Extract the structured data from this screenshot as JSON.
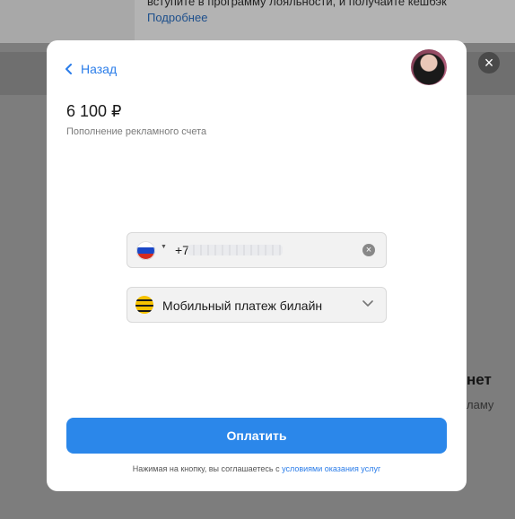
{
  "background": {
    "text_line1": "вступите в программу лояльности, и получайте кешбэк",
    "link": "Подробнее",
    "right_heading": "нет",
    "right_text": "ламу"
  },
  "modal": {
    "back_label": "Назад",
    "amount": "6 100 ₽",
    "subtitle": "Пополнение рекламного счета",
    "phone": {
      "country_icon": "russia-flag",
      "prefix": "+7",
      "clear_icon": "clear-icon"
    },
    "payment_method": {
      "icon": "beeline-logo",
      "label": "Мобильный платеж билайн",
      "chevron_icon": "chevron-down-icon"
    },
    "pay_button": "Оплатить",
    "agreement_text": "Нажимая на кнопку, вы соглашаетесь с ",
    "agreement_link": "условиями оказания услуг"
  },
  "colors": {
    "accent": "#2b87ea",
    "link": "#2b7de9"
  }
}
